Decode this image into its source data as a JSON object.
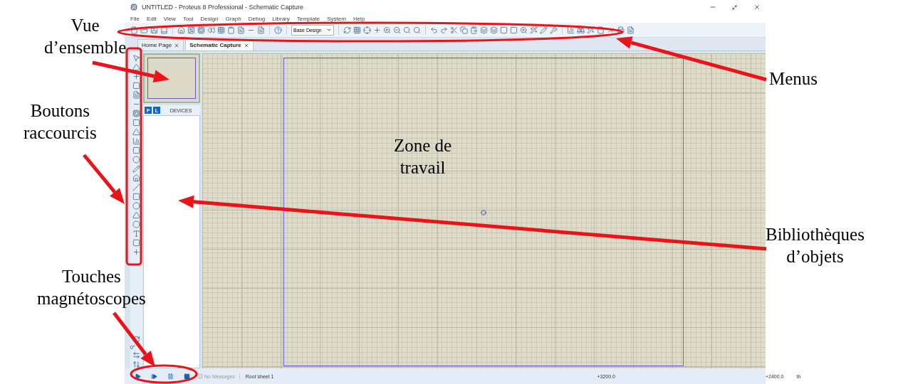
{
  "window": {
    "title": "UNTITLED - Proteus 8 Professional - Schematic Capture"
  },
  "menu": [
    "File",
    "Edit",
    "View",
    "Tool",
    "Design",
    "Graph",
    "Debug",
    "Library",
    "Template",
    "System",
    "Help"
  ],
  "toolbar": {
    "design_select": "Base Design"
  },
  "tabs": [
    {
      "label": "Home Page",
      "selected": false
    },
    {
      "label": "Schematic Capture",
      "selected": true
    }
  ],
  "devices_panel": {
    "buttons": [
      "P",
      "L"
    ],
    "title": "DEVICES"
  },
  "rotation": "0°",
  "status_bar": {
    "message": "No Messages",
    "sheet": "Root sheet 1",
    "x": "+3200.0",
    "y": "+2400.0",
    "unit": "th"
  },
  "annotations": [
    {
      "text": "Vue\nd’ensemble"
    },
    {
      "text": "Boutons\nraccourcis"
    },
    {
      "text": "Touches\nmagnétoscopes"
    },
    {
      "text": "Menus"
    },
    {
      "text": "Bibliothèques\nd’objets"
    },
    {
      "text": "Zone de\ntravail"
    }
  ]
}
